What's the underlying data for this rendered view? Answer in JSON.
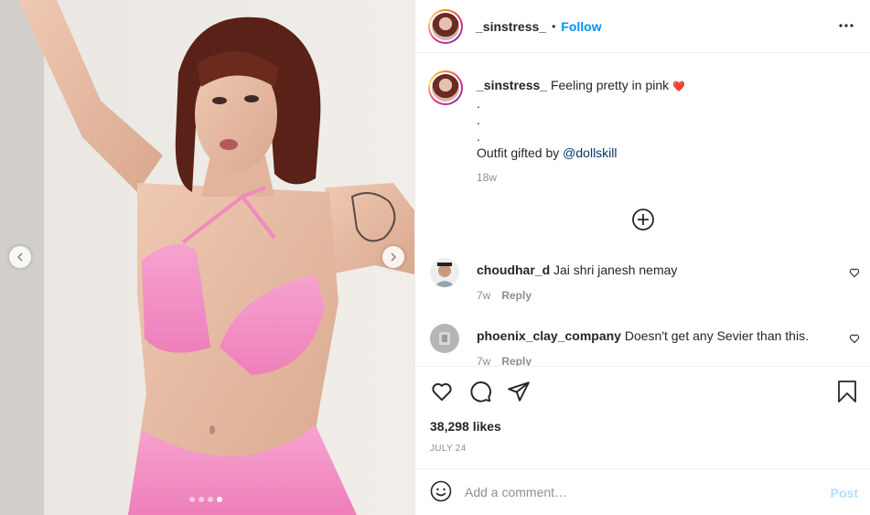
{
  "post": {
    "username": "_sinstress_",
    "separator": "•",
    "follow_label": "Follow",
    "more_icon": "more-horizontal-icon"
  },
  "caption": {
    "username": "_sinstress_",
    "text": "Feeling pretty in pink",
    "emoji": "❤️",
    "dot1": ".",
    "dot2": ".",
    "dot3": ".",
    "gift_prefix": "Outfit gifted by",
    "mention": "@dollskill",
    "time": "18w"
  },
  "comments": [
    {
      "username": "choudhar_d",
      "text": "Jai shri janesh nemay",
      "time": "7w",
      "reply": "Reply"
    },
    {
      "username": "phoenix_clay_company",
      "text": "Doesn't get any Sevier than this.",
      "time": "7w",
      "reply": "Reply"
    }
  ],
  "actions": {
    "likes": "38,298 likes",
    "date": "JULY 24"
  },
  "add_comment": {
    "placeholder": "Add a comment…",
    "post_label": "Post"
  },
  "colors": {
    "accent": "#0095f6",
    "post_disabled": "#b2dffc",
    "muted": "#8e8e8e",
    "top_pink": "#f08ac0"
  },
  "carousel": {
    "slides": 4,
    "active": 4
  }
}
